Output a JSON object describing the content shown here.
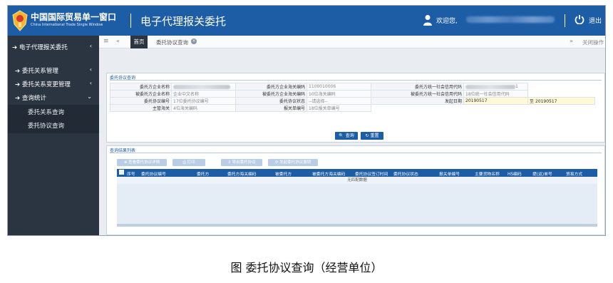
{
  "header": {
    "logo_cn": "中国国际贸易单一窗口",
    "logo_en": "China International Trade Single Window",
    "app_title": "电子代理报关委托",
    "welcome": "欢迎您,",
    "logout": "退出"
  },
  "sidebar": {
    "top": "电子代理报关委托",
    "items": [
      {
        "label": "委托关系管理"
      },
      {
        "label": "委托关系变更管理"
      },
      {
        "label": "查询统计"
      }
    ],
    "sub_items": [
      {
        "label": "委托关系查询"
      },
      {
        "label": "委托协议查询"
      }
    ]
  },
  "tabs": {
    "home": "首页",
    "active": "委托协议查询",
    "close_ops": "关闭操作"
  },
  "query_form": {
    "section_title": "委托协议查询",
    "rows": [
      [
        {
          "label": "委托方企业名称",
          "value": "",
          "kind": "blurred"
        },
        {
          "label": "委托方企业海关编码",
          "value": "1100010006",
          "kind": "value"
        },
        {
          "label": "委托方统一社会信用代码",
          "value": "1",
          "kind": "blurred-tail"
        }
      ],
      [
        {
          "label": "被委托方企业名称",
          "value": "企业中文名称",
          "kind": "placeholder"
        },
        {
          "label": "被委托方企业海关编码",
          "value": "10位海关编码",
          "kind": "placeholder"
        },
        {
          "label": "被委托方统一社会信用代码",
          "value": "18位统一社会信用代码",
          "kind": "placeholder"
        }
      ],
      [
        {
          "label": "委托协议编号",
          "value": "17位委托协议编号",
          "kind": "placeholder"
        },
        {
          "label": "委托协议状态",
          "value": "--请选择--",
          "kind": "placeholder"
        },
        {
          "label": "发起日期",
          "value": "20190517",
          "kind": "date"
        }
      ],
      [
        {
          "label": "主管海关",
          "value": "4位海关编码",
          "kind": "placeholder"
        },
        {
          "label": "报关单编号",
          "value": "18位报关单编号",
          "kind": "placeholder"
        }
      ]
    ],
    "date_to_label": "至",
    "date_to_value": "20190517",
    "query_button": "查询",
    "reset_button": "重置"
  },
  "results": {
    "section_title": "查询结果列表",
    "toolbar": [
      "查看委托协议详情",
      "打印",
      "导出委托协议",
      "发起委托协议撤销"
    ],
    "columns": [
      "序号",
      "委托协议编号",
      "委托方",
      "委托方海关编码",
      "被委托方",
      "被委托方海关编码",
      "委托协议签订时间",
      "委托协议状态",
      "报关单编号",
      "主要货物名称",
      "HS编码",
      "提(运)单号",
      "贸易方式"
    ],
    "empty_text": "无匹配数据"
  },
  "caption": "图  委托协议查询（经营单位）"
}
